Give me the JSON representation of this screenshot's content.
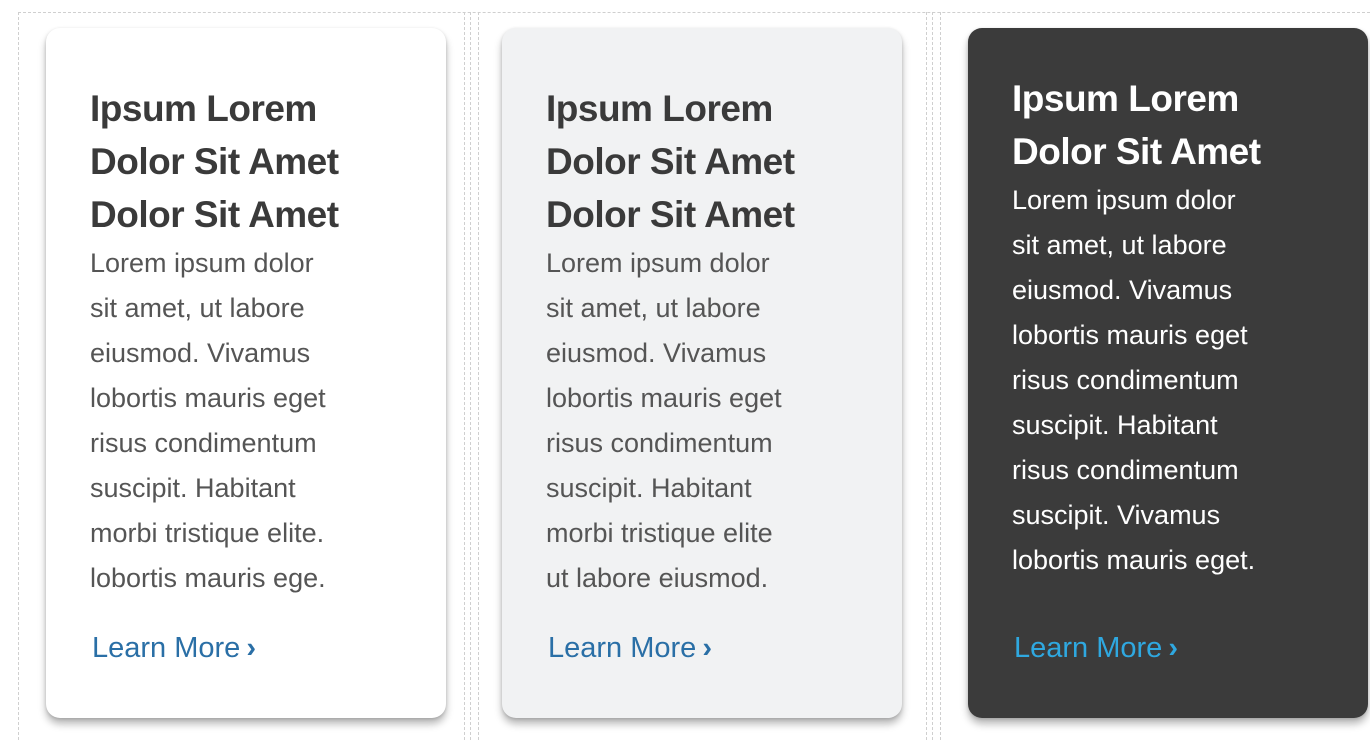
{
  "cards": [
    {
      "title": "Ipsum Lorem\nDolor Sit Amet\nDolor Sit Amet",
      "title_lines": [
        "Ipsum Lorem",
        "Dolor Sit Amet",
        "Dolor Sit Amet"
      ],
      "body_lines": [
        "Lorem ipsum dolor",
        "sit amet, ut labore",
        "eiusmod. Vivamus",
        "lobortis mauris eget",
        "risus condimentum",
        "suscipit. Habitant",
        "morbi tristique elite.",
        "lobortis mauris ege."
      ],
      "link_label": "Learn More",
      "link_icon": "chevron-right-icon",
      "background": "#ffffff"
    },
    {
      "title_lines": [
        "Ipsum Lorem",
        "Dolor Sit Amet",
        "Dolor Sit Amet"
      ],
      "body_lines": [
        "Lorem ipsum dolor",
        "sit amet, ut labore",
        "eiusmod. Vivamus",
        "lobortis mauris eget",
        "risus condimentum",
        "suscipit. Habitant",
        "morbi tristique elite",
        "ut labore eiusmod."
      ],
      "link_label": "Learn More",
      "link_icon": "chevron-right-icon",
      "background": "#f1f2f3"
    },
    {
      "title_lines": [
        "Ipsum Lorem",
        "Dolor Sit Amet"
      ],
      "body_lines": [
        "Lorem ipsum dolor",
        "sit amet, ut labore",
        "eiusmod. Vivamus",
        "lobortis mauris eget",
        "risus condimentum",
        "suscipit. Habitant",
        "risus condimentum",
        "suscipit. Vivamus",
        "lobortis mauris eget."
      ],
      "link_label": "Learn More",
      "link_icon": "chevron-right-icon",
      "background": "#3b3b3b"
    }
  ],
  "colors": {
    "link": "#2a6fa6",
    "link_dark": "#2fa8e0",
    "title": "#3a3a3a",
    "body": "#555555"
  },
  "chevron_glyph": "›"
}
